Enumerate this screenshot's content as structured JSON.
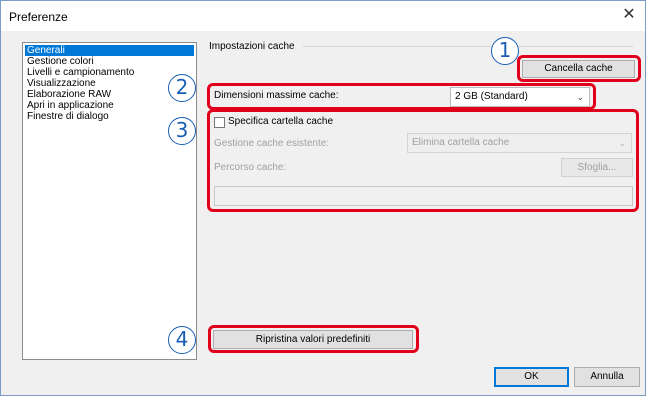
{
  "window": {
    "title": "Preferenze",
    "close_glyph": "✕"
  },
  "sidebar": {
    "items": [
      {
        "label": "Generali",
        "selected": true
      },
      {
        "label": "Gestione colori"
      },
      {
        "label": "Livelli e campionamento"
      },
      {
        "label": "Visualizzazione"
      },
      {
        "label": "Elaborazione RAW"
      },
      {
        "label": "Apri in applicazione"
      },
      {
        "label": "Finestre di dialogo"
      }
    ]
  },
  "cache": {
    "group_label": "Impostazioni cache",
    "clear_button": "Cancella cache",
    "max_size_label": "Dimensioni massime cache:",
    "max_size_value": "2 GB (Standard)",
    "specify_folder_label": "Specifica cartella cache",
    "specify_folder_checked": false,
    "existing_mgmt_label": "Gestione cache esistente:",
    "existing_mgmt_value": "Elimina cartella cache",
    "path_label": "Percorso cache:",
    "browse_button": "Sfoglia...",
    "path_value": ""
  },
  "restore_button": "Ripristina valori predefiniti",
  "footer": {
    "ok": "OK",
    "cancel": "Annulla"
  },
  "callouts": [
    "1",
    "2",
    "3",
    "4"
  ],
  "colors": {
    "highlight": "#e0001b",
    "callout": "#1a5fb4",
    "selection": "#0078d7"
  }
}
